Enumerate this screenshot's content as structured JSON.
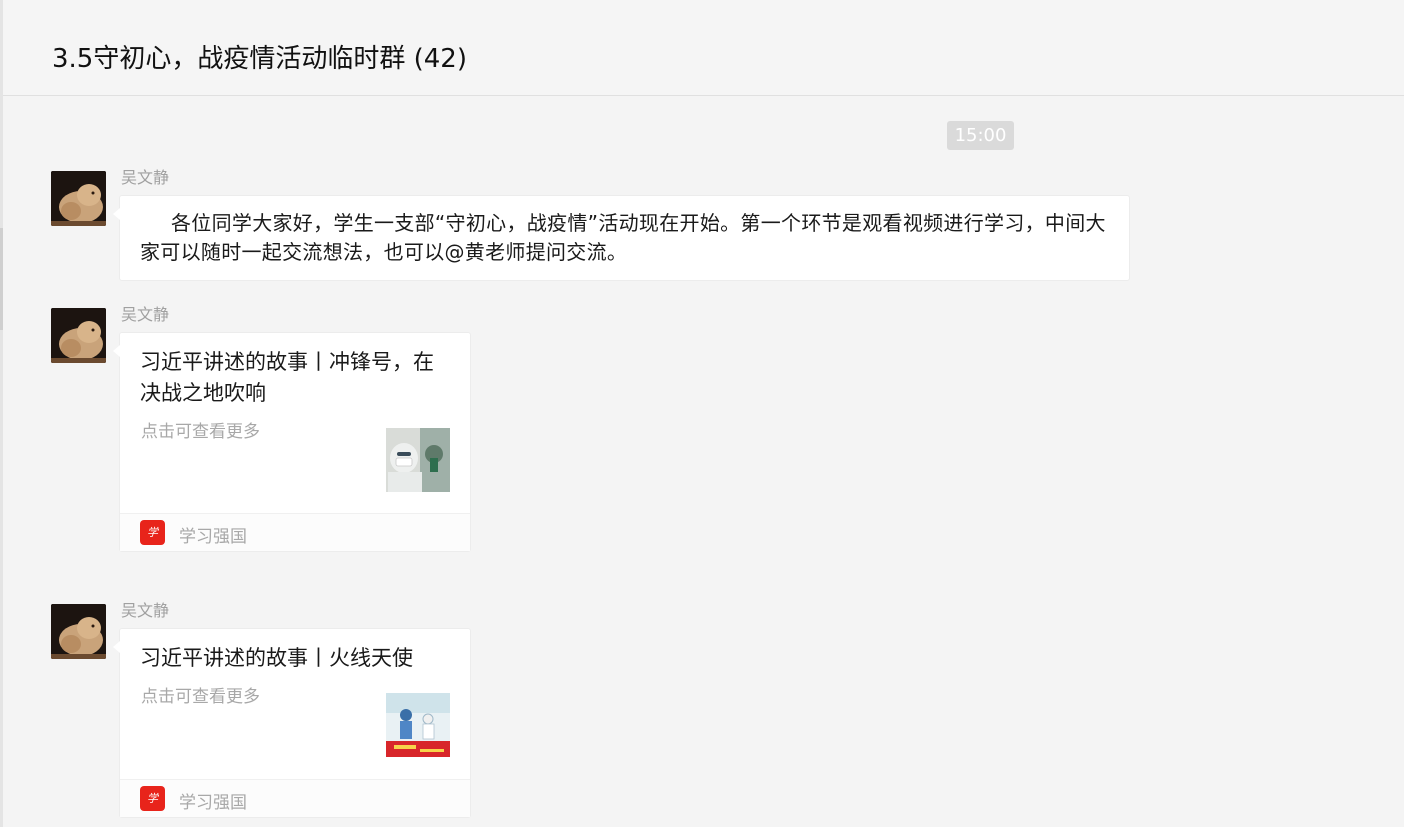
{
  "chat": {
    "title": "3.5守初心，战疫情活动临时群 (42)"
  },
  "timestamp": "15:00",
  "messages": [
    {
      "sender": "吴文静",
      "avatar_icon": "cat-avatar-icon",
      "text": "各位同学大家好，学生一支部“守初心，战疫情”活动现在开始。第一个环节是观看视频进行学习，中间大家可以随时一起交流想法，也可以@黄老师提问交流。"
    },
    {
      "sender": "吴文静",
      "avatar_icon": "cat-avatar-icon",
      "card": {
        "title": "习近平讲述的故事丨冲锋号，在决战之地吹响",
        "description": "点击可查看更多",
        "thumbnail_icon": "medical-worker-thumbnail",
        "source_icon": "xuexi-qiangguo-icon",
        "source": "学习强国"
      }
    },
    {
      "sender": "吴文静",
      "avatar_icon": "cat-avatar-icon",
      "card": {
        "title": "习近平讲述的故事丨火线天使",
        "description": "点击可查看更多",
        "thumbnail_icon": "hospital-scene-thumbnail",
        "source_icon": "xuexi-qiangguo-icon",
        "source": "学习强国"
      }
    }
  ],
  "colors": {
    "background": "#f4f4f4",
    "bubble": "#ffffff",
    "source_icon": "#e8241b",
    "muted_text": "#a8a8a8"
  }
}
